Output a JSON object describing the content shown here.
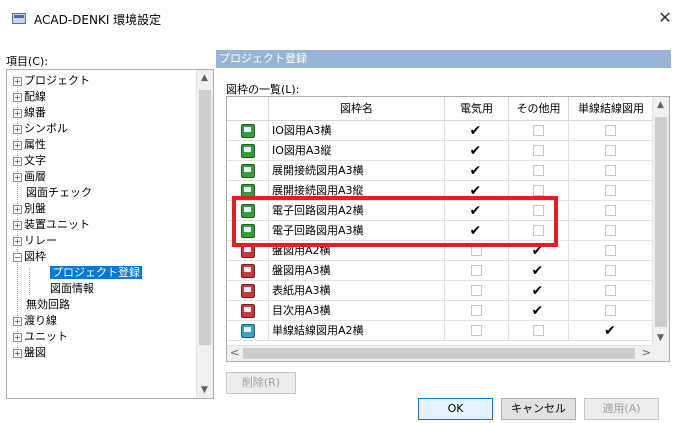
{
  "window": {
    "title": "ACAD-DENKI 環境設定",
    "close_glyph": "✕"
  },
  "tree": {
    "label": "項目(C):",
    "items": [
      {
        "label": "プロジェクト",
        "expander": "+"
      },
      {
        "label": "配線",
        "expander": "+"
      },
      {
        "label": "線番",
        "expander": "+"
      },
      {
        "label": "シンボル",
        "expander": "+"
      },
      {
        "label": "属性",
        "expander": "+"
      },
      {
        "label": "文字",
        "expander": "+"
      },
      {
        "label": "画層",
        "expander": "+"
      },
      {
        "label": "図面チェック",
        "expander": ""
      },
      {
        "label": "別盤",
        "expander": "+"
      },
      {
        "label": "装置ユニット",
        "expander": "+"
      },
      {
        "label": "リレー",
        "expander": "+"
      },
      {
        "label": "図枠",
        "expander": "−"
      },
      {
        "label": "プロジェクト登録",
        "expander": "",
        "selected": true
      },
      {
        "label": "図面情報",
        "expander": ""
      },
      {
        "label": "無効回路",
        "expander": ""
      },
      {
        "label": "渡り線",
        "expander": "+"
      },
      {
        "label": "ユニット",
        "expander": "+"
      },
      {
        "label": "盤図",
        "expander": "+"
      }
    ]
  },
  "panel": {
    "header": "プロジェクト登録",
    "list_label": "図枠の一覧(L):",
    "columns": [
      "図枠名",
      "電気用",
      "その他用",
      "単線結線図用"
    ],
    "rows": [
      {
        "name": "IO図用A3横",
        "icon": "green",
        "elec": true,
        "other": false,
        "single": false
      },
      {
        "name": "IO図用A3縦",
        "icon": "green",
        "elec": true,
        "other": false,
        "single": false
      },
      {
        "name": "展開接続図用A3横",
        "icon": "green",
        "elec": true,
        "other": false,
        "single": false
      },
      {
        "name": "展開接続図用A3縦",
        "icon": "green",
        "elec": true,
        "other": false,
        "single": false
      },
      {
        "name": "電子回路図用A2横",
        "icon": "green",
        "elec": true,
        "other": false,
        "single": false
      },
      {
        "name": "電子回路図用A3横",
        "icon": "green",
        "elec": true,
        "other": false,
        "single": false
      },
      {
        "name": "盤図用A2横",
        "icon": "red",
        "elec": false,
        "other": true,
        "single": false
      },
      {
        "name": "盤図用A3横",
        "icon": "red",
        "elec": false,
        "other": true,
        "single": false
      },
      {
        "name": "表紙用A3横",
        "icon": "red",
        "elec": false,
        "other": true,
        "single": false
      },
      {
        "name": "目次用A3横",
        "icon": "red",
        "elec": false,
        "other": true,
        "single": false
      },
      {
        "name": "単線結線図用A2横",
        "icon": "cyan",
        "elec": false,
        "other": false,
        "single": true
      }
    ],
    "delete_button": "削除(R)"
  },
  "buttons": {
    "ok": "OK",
    "cancel": "キャンセル",
    "apply": "適用(A)"
  },
  "colors": {
    "accent": "#0078d7",
    "header_bg": "#98b4d4",
    "highlight": "#e41e1e"
  }
}
